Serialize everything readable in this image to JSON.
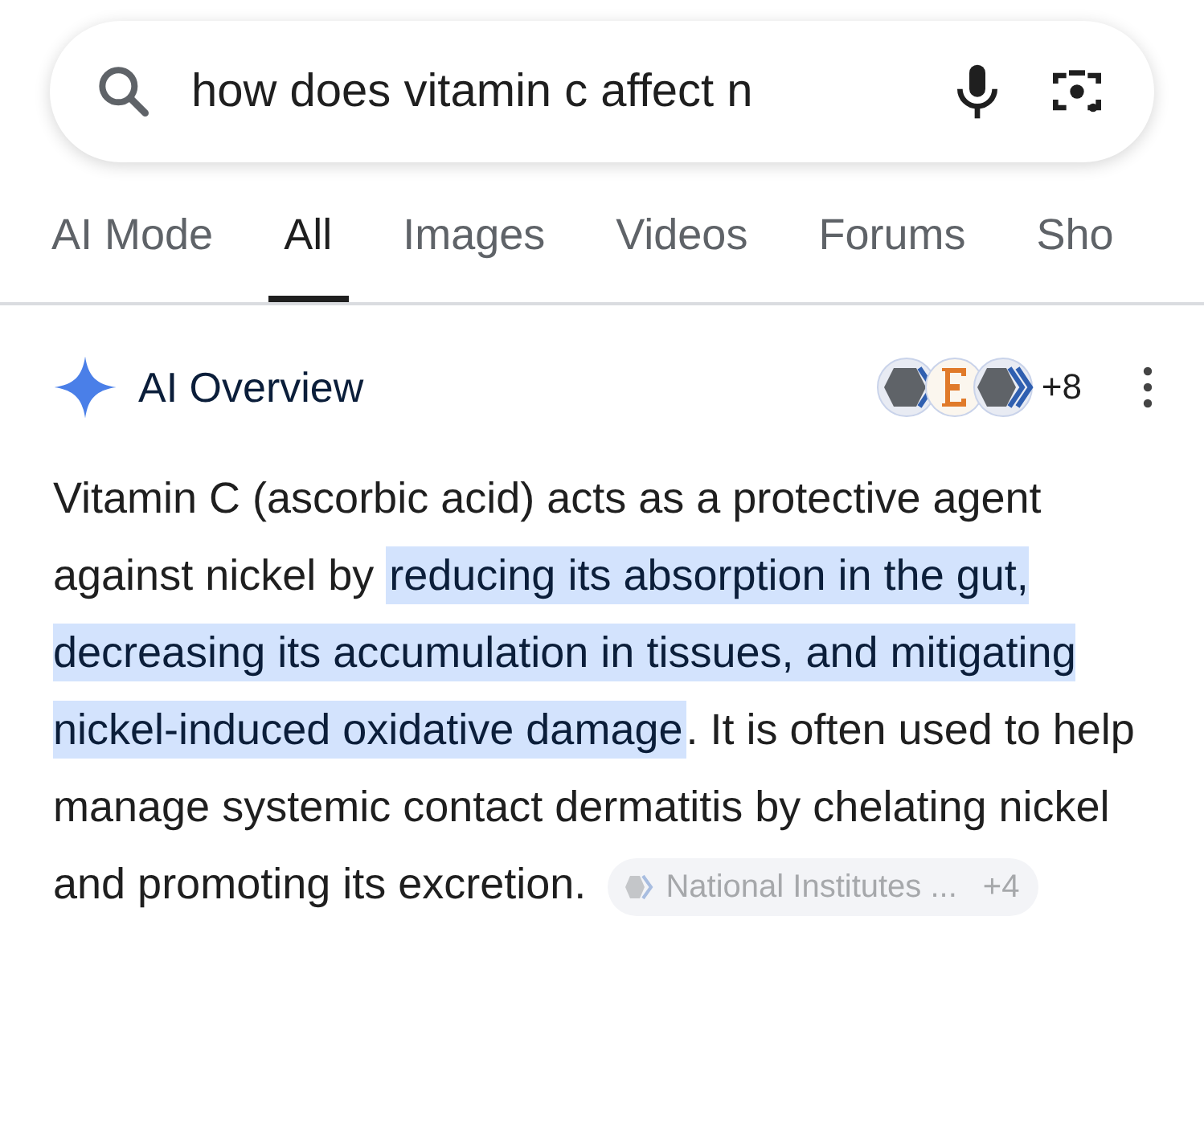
{
  "search": {
    "value": "how does vitamin c affect n"
  },
  "tabs": [
    {
      "label": "AI Mode",
      "selected": false
    },
    {
      "label": "All",
      "selected": true
    },
    {
      "label": "Images",
      "selected": false
    },
    {
      "label": "Videos",
      "selected": false
    },
    {
      "label": "Forums",
      "selected": false
    },
    {
      "label": "Sho",
      "selected": false
    }
  ],
  "overview": {
    "title": "AI Overview",
    "sources_more": "+8",
    "answer": {
      "before": "Vitamin C (ascorbic acid) acts as a protective agent against nickel by ",
      "highlight": "reducing its absorption in the gut, decreasing its accumulation in tissues, and mitigating nickel-induced oxidative damage",
      "after": ". It is often used to help manage systemic contact dermatitis by chelating nickel and promoting its excretion."
    },
    "source_chip": {
      "label": "National Institutes ...",
      "count": "+4"
    }
  }
}
